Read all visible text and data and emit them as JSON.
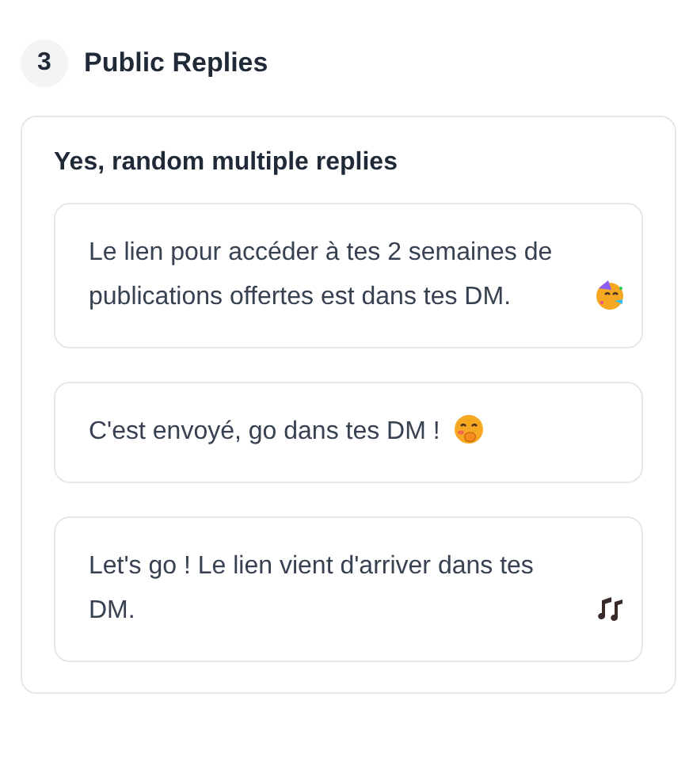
{
  "section": {
    "number": "3",
    "title": "Public Replies"
  },
  "panel": {
    "title": "Yes, random multiple replies",
    "replies": [
      {
        "text": "Le lien pour accéder à tes 2 semaines de publications offertes est dans tes DM.",
        "kind": "party"
      },
      {
        "text": "C'est envoyé, go dans tes DM !",
        "kind": "giggle"
      },
      {
        "text": "Let's go ! Le lien vient d'arriver dans tes DM.",
        "kind": "music"
      }
    ]
  }
}
